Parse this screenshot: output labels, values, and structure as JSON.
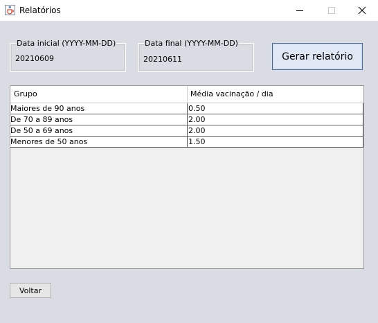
{
  "window": {
    "title": "Relatórios",
    "icon": "java-cup-icon"
  },
  "form": {
    "data_inicial": {
      "label": "Data inicial (YYYY-MM-DD)",
      "value": "20210609"
    },
    "data_final": {
      "label": "Data final (YYYY-MM-DD)",
      "value": "20210611"
    },
    "gerar_label": "Gerar relatório"
  },
  "table": {
    "headers": [
      "Grupo",
      "Média vacinação / dia"
    ],
    "rows": [
      [
        "Maiores de 90 anos",
        "0.50"
      ],
      [
        "De 70 a 89 anos",
        "2.00"
      ],
      [
        "De 50 a 69 anos",
        "2.00"
      ],
      [
        "Menores de 50 anos",
        "1.50"
      ]
    ]
  },
  "footer": {
    "voltar_label": "Voltar"
  }
}
